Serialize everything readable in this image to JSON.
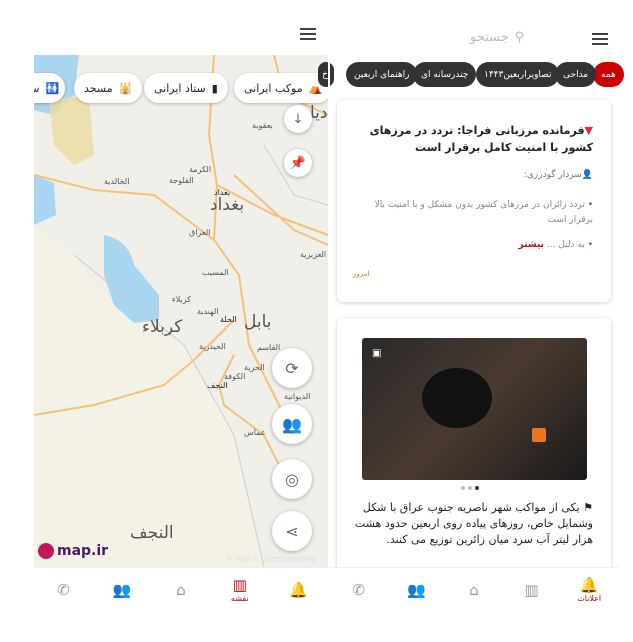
{
  "left": {
    "chips": [
      {
        "icon": "tent-icon",
        "label": "موکب ایرانی"
      },
      {
        "icon": "building-icon",
        "label": "ستاد ایرانی"
      },
      {
        "icon": "mosque-icon",
        "label": "مسجد"
      },
      {
        "icon": "restroom-icon",
        "label": "س"
      }
    ],
    "map_labels": {
      "baquba": "بعقوبة",
      "karma": "الكرمة",
      "fallujah": "الفلوجة",
      "khalidiya": "الخالدية",
      "baghdad_small": "بغداد",
      "baghdad_big": "بغداد",
      "iraq": "العراق",
      "aziziya": "العزيزية",
      "musayyib": "المسيب",
      "karbala_small": "كربلاء",
      "karbala_big": "كربلاء",
      "hindiya": "الهندية",
      "hilla": "الحلة",
      "babil_big": "بابل",
      "haidariya": "الحيدرية",
      "qasim": "القاسم",
      "kufa": "الكوفة",
      "hurriya": "الحرية",
      "najaf_small": "النجف",
      "diwaniya": "الديوانية",
      "ghammas": "غماس",
      "najaf_big": "النجف",
      "diyala_partial": "ديا"
    },
    "logo": "map.ir",
    "attribution": "© Map © OpenStreetMap",
    "nav": [
      {
        "icon": "phone-icon"
      },
      {
        "icon": "people-icon"
      },
      {
        "icon": "home-icon"
      },
      {
        "icon": "map-icon",
        "label": "نقشه",
        "active": true
      },
      {
        "icon": "bell-icon"
      }
    ]
  },
  "right": {
    "search_placeholder": "جستجو",
    "filters": [
      "همه",
      "مداحی",
      "تصاویراربعین۱۴۴۳",
      "چندرسانه ای",
      "راهنمای اربعین",
      "اخ"
    ],
    "card1": {
      "title": "فرمانده مرزبانی فراجا: تردد در مرزهای کشور با امنیت کامل برقرار است",
      "author": "سردار گودرزی:",
      "bullet1": "تردد زائران در مرزهای کشور بدون مشکل و با امنیت بالا برقرار است",
      "bullet2": "به دلیل ...",
      "more": "بیشتر",
      "date": "امروز"
    },
    "card2": {
      "text": "یکی از مواکب شهر ناصریه جنوب عراق با شکل وشمایل خاص، روزهای پیاده روی اربعین حدود هشت هزار لیتر آب سرد میان زائرین توزیع می کنند.",
      "slide_index": 1,
      "slide_count": 3
    },
    "nav": [
      {
        "icon": "phone-icon"
      },
      {
        "icon": "people-icon"
      },
      {
        "icon": "home-icon"
      },
      {
        "icon": "map-icon"
      },
      {
        "icon": "bell-icon",
        "label": "اعلانات",
        "active": true
      }
    ]
  },
  "colors": {
    "accent": "#b01010",
    "pill": "#333333",
    "water": "#a8d5f0",
    "road": "#f2c27a"
  }
}
